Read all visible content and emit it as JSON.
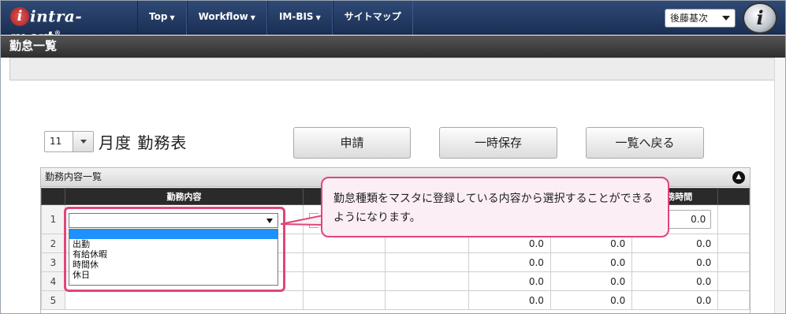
{
  "header": {
    "logo_text": "intra-mart",
    "logo_mark": "i",
    "logo_tm": "®",
    "nav": [
      {
        "label": "Top"
      },
      {
        "label": "Workflow"
      },
      {
        "label": "IM-BIS"
      },
      {
        "label": "サイトマップ"
      }
    ],
    "user_name": "後藤基次",
    "user_icon_letter": "i"
  },
  "page": {
    "title": "勤怠一覧"
  },
  "form": {
    "month_value": "11",
    "month_label": "月度 勤務表",
    "buttons": {
      "apply": "申請",
      "temp_save": "一時保存",
      "back": "一覧へ戻る"
    }
  },
  "panel": {
    "title": "勤務内容一覧",
    "columns": {
      "content": "勤務内容",
      "work_time": "勤務時間"
    },
    "rows": [
      {
        "num": "1",
        "v": [
          "",
          "",
          "",
          "",
          "0.0"
        ]
      },
      {
        "num": "2",
        "v": [
          "",
          "0.0",
          "0.0",
          "0.0"
        ]
      },
      {
        "num": "3",
        "v": [
          "",
          "0.0",
          "0.0",
          "0.0"
        ]
      },
      {
        "num": "4",
        "v": [
          "",
          "0.0",
          "0.0",
          "0.0"
        ]
      },
      {
        "num": "5",
        "v": [
          "",
          "0.0",
          "0.0",
          "0.0"
        ]
      }
    ]
  },
  "dropdown": {
    "options": [
      "",
      "出勤",
      "有給休暇",
      "時間休",
      "休日"
    ]
  },
  "callout": {
    "text": "勤怠種類をマスタに登録している内容から選択することができるようになります。"
  },
  "colors": {
    "accent": "#e0457b",
    "nav_bg": "#1b2f54",
    "selected": "#1e90ff"
  }
}
